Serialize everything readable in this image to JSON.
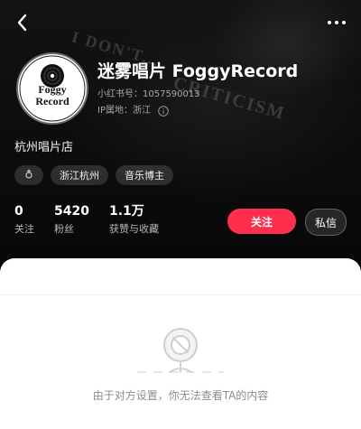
{
  "header": {
    "background_text": [
      "I DON'T...",
      "CRITICISM"
    ],
    "profile": {
      "name": "迷雾唱片 FoggyRecord",
      "id_text": "小红书号：1057590013",
      "ip_text": "IP属地：浙江",
      "avatar_text": [
        "Foggy",
        "Record"
      ]
    },
    "description": "杭州唱片店",
    "tags": [
      "浙江杭州",
      "音乐博主"
    ],
    "stats": [
      {
        "value": "0",
        "label": "关注"
      },
      {
        "value": "5420",
        "label": "粉丝"
      },
      {
        "value": "1.1万",
        "label": "获赞与收藏"
      }
    ],
    "buttons": {
      "follow": "关注",
      "message": "私信"
    }
  },
  "main": {
    "empty_message": "由于对方设置，你无法查看TA的内容"
  },
  "colors": {
    "header_bg": "#151515",
    "accent_red": "#ff2e4d",
    "sheet_bg": "#ffffff",
    "muted_text": "#8c8c8c"
  },
  "icons": {
    "back": "chevron-left-icon",
    "more": "more-dots-icon",
    "info": "info-circle-icon",
    "gender": "gender-icon",
    "empty": "no-content-icon"
  }
}
